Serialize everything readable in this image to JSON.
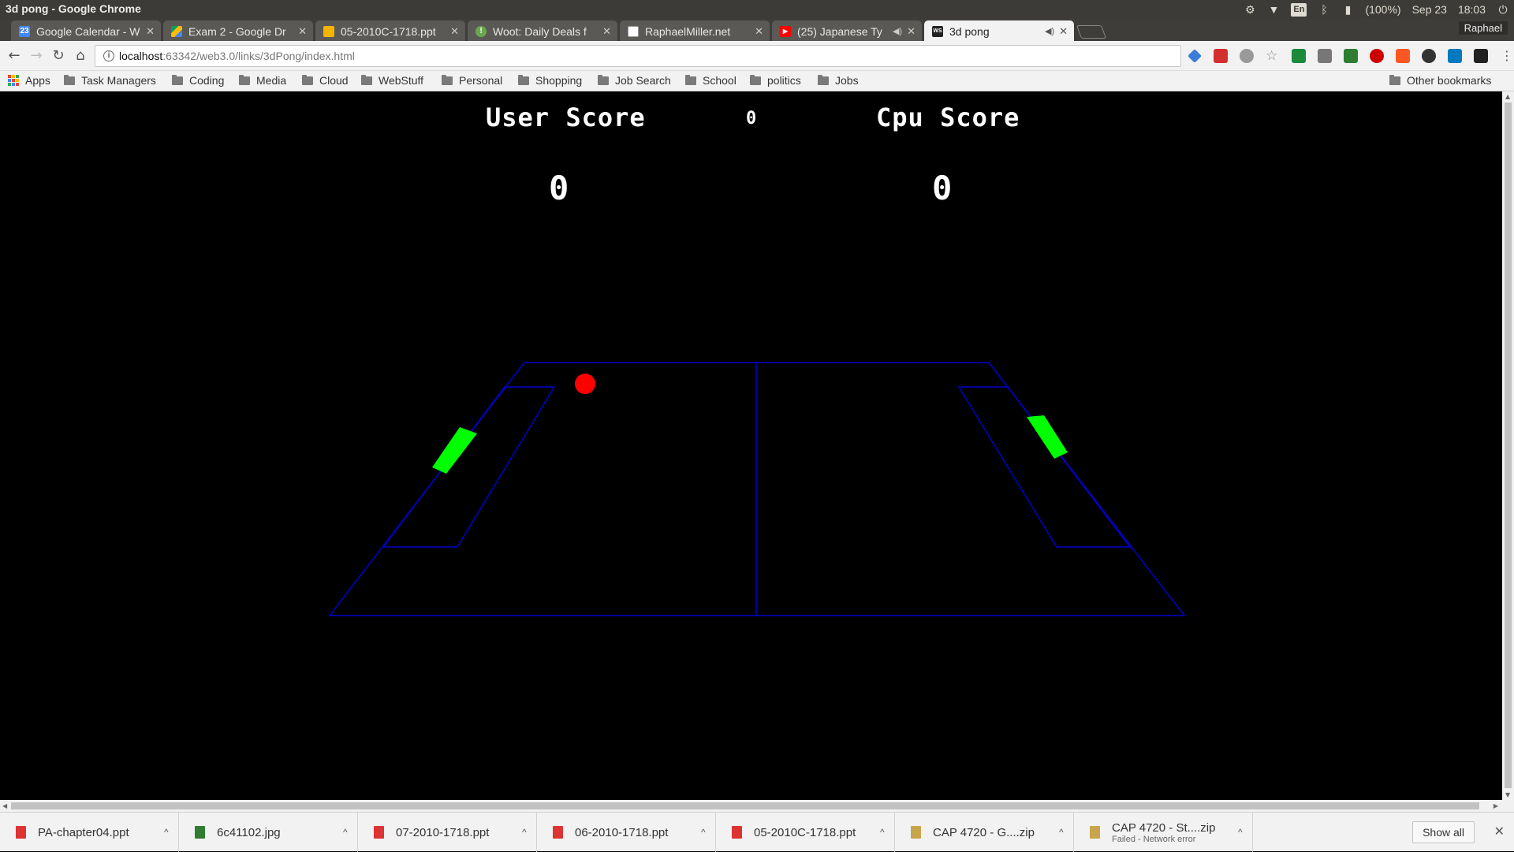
{
  "os": {
    "window_title": "3d pong - Google Chrome",
    "lang": "En",
    "battery": "(100%)",
    "date": "Sep 23",
    "time": "18:03"
  },
  "browser": {
    "profile": "Raphael",
    "tabs": [
      {
        "title": "Google Calendar - W",
        "favicon": "calendar-icon",
        "color": "#4285f4",
        "fav_text": "23"
      },
      {
        "title": "Exam 2 - Google Dr",
        "favicon": "drive-icon",
        "color": "#fbbc05",
        "fav_text": ""
      },
      {
        "title": "05-2010C-1718.ppt",
        "favicon": "slides-icon",
        "color": "#f4b400",
        "fav_text": ""
      },
      {
        "title": "Woot: Daily Deals f",
        "favicon": "woot-icon",
        "color": "#6aa84f",
        "fav_text": "!"
      },
      {
        "title": "RaphaelMiller.net",
        "favicon": "page-icon",
        "color": "#ffffff",
        "fav_text": ""
      },
      {
        "title": "(25) Japanese Ty",
        "favicon": "youtube-icon",
        "color": "#ff0000",
        "fav_text": "▶"
      },
      {
        "title": "3d pong",
        "favicon": "webstorm-icon",
        "color": "#222222",
        "fav_text": "WS"
      }
    ],
    "url_host": "localhost",
    "url_path": ":63342/web3.0/links/3dPong/index.html",
    "bookmarks": [
      "Apps",
      "Task Managers",
      "Coding",
      "Media",
      "Cloud",
      "WebStuff",
      "Personal",
      "Shopping",
      "Job Search",
      "School",
      "politics",
      "Jobs"
    ],
    "other_bookmarks": "Other bookmarks"
  },
  "game": {
    "user_label": "User Score",
    "cpu_label": "Cpu Score",
    "center_value": "0",
    "user_score": "0",
    "cpu_score": "0",
    "colors": {
      "court": "#0000cc",
      "paddle": "#00ff00",
      "ball": "#ff0000"
    }
  },
  "downloads": {
    "items": [
      {
        "name": "PA-chapter04.ppt",
        "status": "",
        "type": "ppt"
      },
      {
        "name": "6c41102.jpg",
        "status": "",
        "type": "jpg"
      },
      {
        "name": "07-2010-1718.ppt",
        "status": "",
        "type": "ppt"
      },
      {
        "name": "06-2010-1718.ppt",
        "status": "",
        "type": "ppt"
      },
      {
        "name": "05-2010C-1718.ppt",
        "status": "",
        "type": "ppt"
      },
      {
        "name": "CAP 4720 - G....zip",
        "status": "",
        "type": "zip"
      },
      {
        "name": "CAP 4720 - St....zip",
        "status": "Failed - Network error",
        "type": "zip"
      }
    ],
    "show_all": "Show all"
  }
}
